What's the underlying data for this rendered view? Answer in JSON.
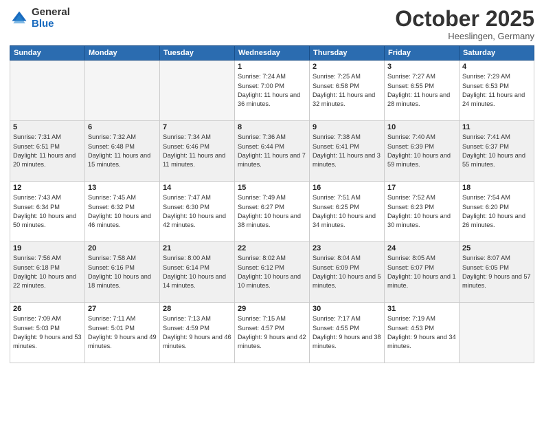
{
  "logo": {
    "general": "General",
    "blue": "Blue"
  },
  "title": "October 2025",
  "location": "Heeslingen, Germany",
  "days_of_week": [
    "Sunday",
    "Monday",
    "Tuesday",
    "Wednesday",
    "Thursday",
    "Friday",
    "Saturday"
  ],
  "weeks": [
    [
      {
        "day": "",
        "empty": true
      },
      {
        "day": "",
        "empty": true
      },
      {
        "day": "",
        "empty": true
      },
      {
        "day": "1",
        "sunrise": "Sunrise: 7:24 AM",
        "sunset": "Sunset: 7:00 PM",
        "daylight": "Daylight: 11 hours and 36 minutes."
      },
      {
        "day": "2",
        "sunrise": "Sunrise: 7:25 AM",
        "sunset": "Sunset: 6:58 PM",
        "daylight": "Daylight: 11 hours and 32 minutes."
      },
      {
        "day": "3",
        "sunrise": "Sunrise: 7:27 AM",
        "sunset": "Sunset: 6:55 PM",
        "daylight": "Daylight: 11 hours and 28 minutes."
      },
      {
        "day": "4",
        "sunrise": "Sunrise: 7:29 AM",
        "sunset": "Sunset: 6:53 PM",
        "daylight": "Daylight: 11 hours and 24 minutes."
      }
    ],
    [
      {
        "day": "5",
        "sunrise": "Sunrise: 7:31 AM",
        "sunset": "Sunset: 6:51 PM",
        "daylight": "Daylight: 11 hours and 20 minutes."
      },
      {
        "day": "6",
        "sunrise": "Sunrise: 7:32 AM",
        "sunset": "Sunset: 6:48 PM",
        "daylight": "Daylight: 11 hours and 15 minutes."
      },
      {
        "day": "7",
        "sunrise": "Sunrise: 7:34 AM",
        "sunset": "Sunset: 6:46 PM",
        "daylight": "Daylight: 11 hours and 11 minutes."
      },
      {
        "day": "8",
        "sunrise": "Sunrise: 7:36 AM",
        "sunset": "Sunset: 6:44 PM",
        "daylight": "Daylight: 11 hours and 7 minutes."
      },
      {
        "day": "9",
        "sunrise": "Sunrise: 7:38 AM",
        "sunset": "Sunset: 6:41 PM",
        "daylight": "Daylight: 11 hours and 3 minutes."
      },
      {
        "day": "10",
        "sunrise": "Sunrise: 7:40 AM",
        "sunset": "Sunset: 6:39 PM",
        "daylight": "Daylight: 10 hours and 59 minutes."
      },
      {
        "day": "11",
        "sunrise": "Sunrise: 7:41 AM",
        "sunset": "Sunset: 6:37 PM",
        "daylight": "Daylight: 10 hours and 55 minutes."
      }
    ],
    [
      {
        "day": "12",
        "sunrise": "Sunrise: 7:43 AM",
        "sunset": "Sunset: 6:34 PM",
        "daylight": "Daylight: 10 hours and 50 minutes."
      },
      {
        "day": "13",
        "sunrise": "Sunrise: 7:45 AM",
        "sunset": "Sunset: 6:32 PM",
        "daylight": "Daylight: 10 hours and 46 minutes."
      },
      {
        "day": "14",
        "sunrise": "Sunrise: 7:47 AM",
        "sunset": "Sunset: 6:30 PM",
        "daylight": "Daylight: 10 hours and 42 minutes."
      },
      {
        "day": "15",
        "sunrise": "Sunrise: 7:49 AM",
        "sunset": "Sunset: 6:27 PM",
        "daylight": "Daylight: 10 hours and 38 minutes."
      },
      {
        "day": "16",
        "sunrise": "Sunrise: 7:51 AM",
        "sunset": "Sunset: 6:25 PM",
        "daylight": "Daylight: 10 hours and 34 minutes."
      },
      {
        "day": "17",
        "sunrise": "Sunrise: 7:52 AM",
        "sunset": "Sunset: 6:23 PM",
        "daylight": "Daylight: 10 hours and 30 minutes."
      },
      {
        "day": "18",
        "sunrise": "Sunrise: 7:54 AM",
        "sunset": "Sunset: 6:20 PM",
        "daylight": "Daylight: 10 hours and 26 minutes."
      }
    ],
    [
      {
        "day": "19",
        "sunrise": "Sunrise: 7:56 AM",
        "sunset": "Sunset: 6:18 PM",
        "daylight": "Daylight: 10 hours and 22 minutes."
      },
      {
        "day": "20",
        "sunrise": "Sunrise: 7:58 AM",
        "sunset": "Sunset: 6:16 PM",
        "daylight": "Daylight: 10 hours and 18 minutes."
      },
      {
        "day": "21",
        "sunrise": "Sunrise: 8:00 AM",
        "sunset": "Sunset: 6:14 PM",
        "daylight": "Daylight: 10 hours and 14 minutes."
      },
      {
        "day": "22",
        "sunrise": "Sunrise: 8:02 AM",
        "sunset": "Sunset: 6:12 PM",
        "daylight": "Daylight: 10 hours and 10 minutes."
      },
      {
        "day": "23",
        "sunrise": "Sunrise: 8:04 AM",
        "sunset": "Sunset: 6:09 PM",
        "daylight": "Daylight: 10 hours and 5 minutes."
      },
      {
        "day": "24",
        "sunrise": "Sunrise: 8:05 AM",
        "sunset": "Sunset: 6:07 PM",
        "daylight": "Daylight: 10 hours and 1 minute."
      },
      {
        "day": "25",
        "sunrise": "Sunrise: 8:07 AM",
        "sunset": "Sunset: 6:05 PM",
        "daylight": "Daylight: 9 hours and 57 minutes."
      }
    ],
    [
      {
        "day": "26",
        "sunrise": "Sunrise: 7:09 AM",
        "sunset": "Sunset: 5:03 PM",
        "daylight": "Daylight: 9 hours and 53 minutes."
      },
      {
        "day": "27",
        "sunrise": "Sunrise: 7:11 AM",
        "sunset": "Sunset: 5:01 PM",
        "daylight": "Daylight: 9 hours and 49 minutes."
      },
      {
        "day": "28",
        "sunrise": "Sunrise: 7:13 AM",
        "sunset": "Sunset: 4:59 PM",
        "daylight": "Daylight: 9 hours and 46 minutes."
      },
      {
        "day": "29",
        "sunrise": "Sunrise: 7:15 AM",
        "sunset": "Sunset: 4:57 PM",
        "daylight": "Daylight: 9 hours and 42 minutes."
      },
      {
        "day": "30",
        "sunrise": "Sunrise: 7:17 AM",
        "sunset": "Sunset: 4:55 PM",
        "daylight": "Daylight: 9 hours and 38 minutes."
      },
      {
        "day": "31",
        "sunrise": "Sunrise: 7:19 AM",
        "sunset": "Sunset: 4:53 PM",
        "daylight": "Daylight: 9 hours and 34 minutes."
      },
      {
        "day": "",
        "empty": true
      }
    ]
  ]
}
